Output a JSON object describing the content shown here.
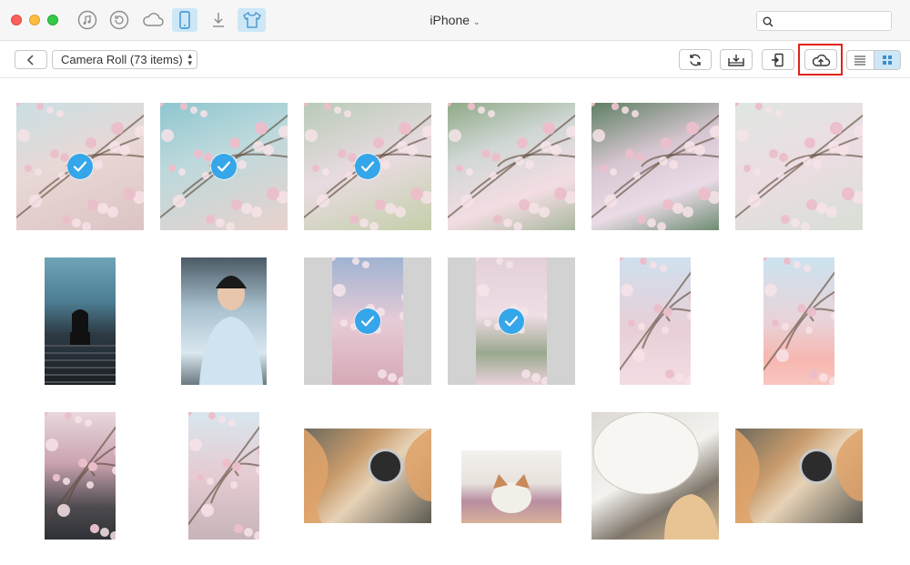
{
  "window": {
    "device_name": "iPhone",
    "device_chevron": "⌄"
  },
  "titlebar_icons": [
    "music-icon",
    "restore-icon",
    "cloud-icon",
    "phone-icon",
    "download-icon",
    "shirt-icon"
  ],
  "search": {
    "placeholder": "",
    "value": ""
  },
  "toolbar": {
    "album_label": "Camera Roll (73 items)",
    "buttons": [
      "refresh-icon",
      "export-to-computer-icon",
      "import-icon",
      "upload-to-cloud-icon"
    ]
  },
  "colors": {
    "accent": "#35a6ea",
    "active_bg": "#cde7f7",
    "highlight": "#e2231a"
  },
  "photos": [
    {
      "kind": "blossom-sky",
      "selected": true
    },
    {
      "kind": "blossom-teal",
      "selected": true
    },
    {
      "kind": "blossom-branches",
      "selected": true
    },
    {
      "kind": "blossom-green",
      "selected": false
    },
    {
      "kind": "blossom-dense",
      "selected": false
    },
    {
      "kind": "blossom-light",
      "selected": false
    },
    {
      "kind": "person-stairs",
      "selected": false
    },
    {
      "kind": "person-beanie",
      "selected": false
    },
    {
      "kind": "blossom-portrait-grey",
      "selected": true
    },
    {
      "kind": "blossom-portrait-soft",
      "selected": true
    },
    {
      "kind": "blossom-portrait-sky",
      "selected": false
    },
    {
      "kind": "blossom-portrait-pink",
      "selected": false
    },
    {
      "kind": "blossom-tree-portrait",
      "selected": false
    },
    {
      "kind": "blossom-branch-portrait",
      "selected": false
    },
    {
      "kind": "dog-mirror",
      "selected": false
    },
    {
      "kind": "dog-couch",
      "selected": false
    },
    {
      "kind": "dog-bowl",
      "selected": false
    },
    {
      "kind": "dog-mirror-2",
      "selected": false
    }
  ]
}
